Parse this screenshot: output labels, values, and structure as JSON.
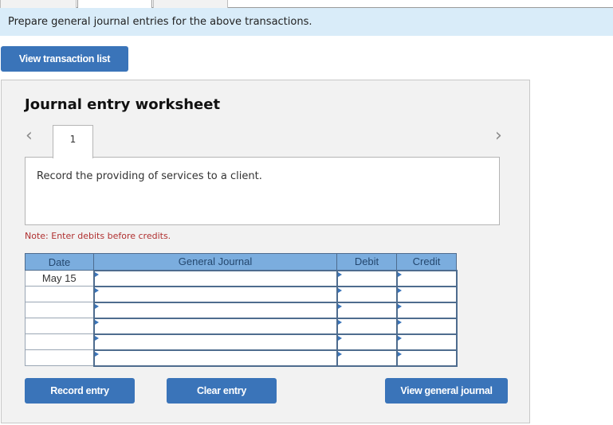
{
  "instruction": "Prepare general journal entries for the above transactions.",
  "view_transaction_list_label": "View transaction list",
  "worksheet": {
    "title": "Journal entry worksheet",
    "current_step": "1",
    "description": "Record the providing of services to a client.",
    "note": "Note: Enter debits before credits.",
    "prev_icon": "chevron-left-icon",
    "next_icon": "chevron-right-icon"
  },
  "journal": {
    "headers": {
      "date": "Date",
      "account": "General Journal",
      "debit": "Debit",
      "credit": "Credit"
    },
    "rows": [
      {
        "date": "May 15",
        "account": "",
        "debit": "",
        "credit": ""
      },
      {
        "date": "",
        "account": "",
        "debit": "",
        "credit": ""
      },
      {
        "date": "",
        "account": "",
        "debit": "",
        "credit": ""
      },
      {
        "date": "",
        "account": "",
        "debit": "",
        "credit": ""
      },
      {
        "date": "",
        "account": "",
        "debit": "",
        "credit": ""
      },
      {
        "date": "",
        "account": "",
        "debit": "",
        "credit": ""
      }
    ]
  },
  "buttons": {
    "record_entry": "Record entry",
    "clear_entry": "Clear entry",
    "view_general_journal": "View general journal"
  },
  "colors": {
    "button_blue": "#3a74b9",
    "header_blue": "#7badde",
    "instruction_bg": "#d9ecf9",
    "note_red": "#b03030"
  }
}
